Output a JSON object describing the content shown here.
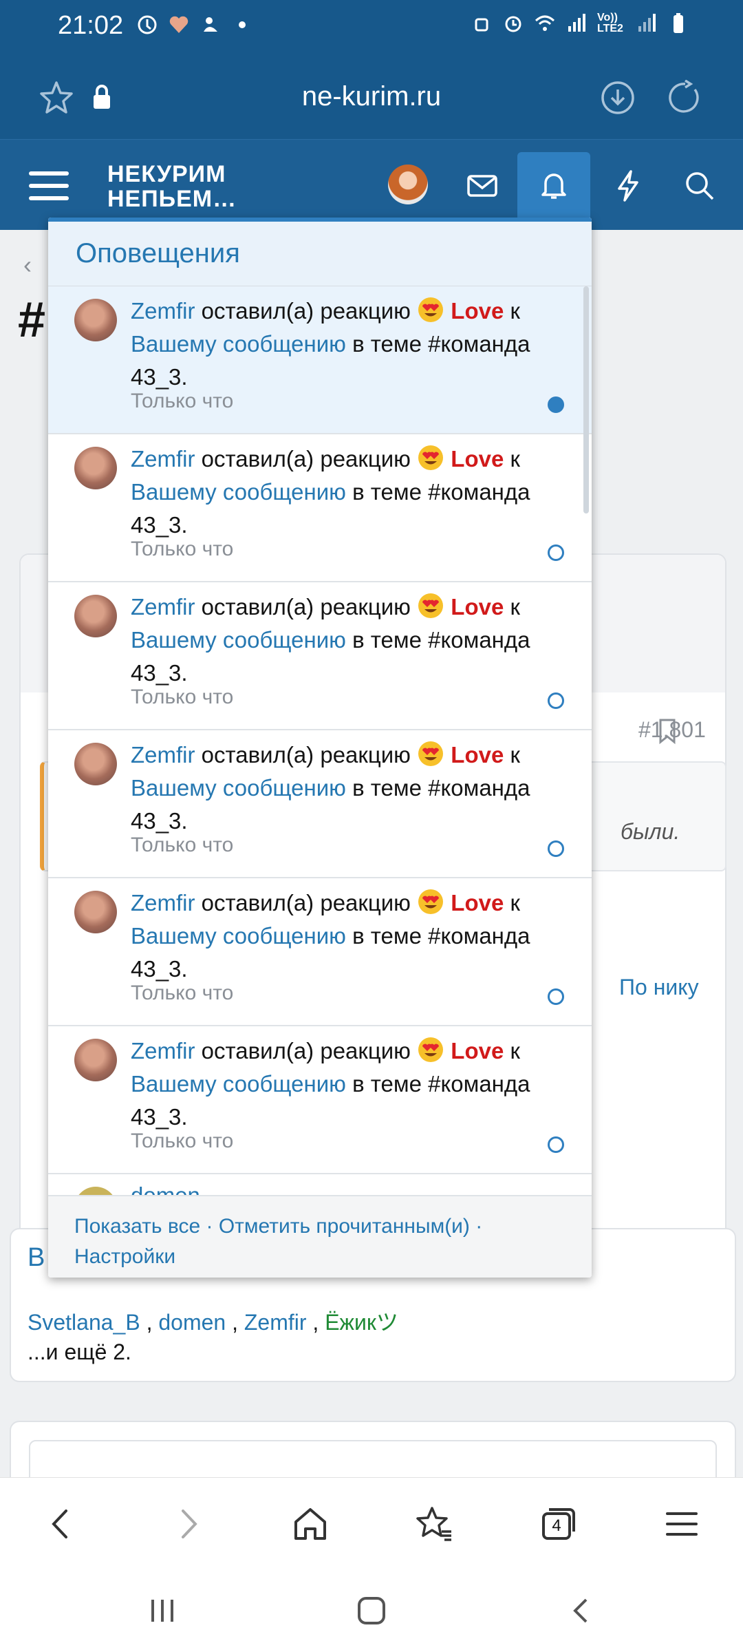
{
  "status_bar": {
    "time": "21:02",
    "network": "Vo)) LTE2"
  },
  "browser": {
    "url": "ne-kurim.ru"
  },
  "site": {
    "logo_line1": "НЕКУРИМ",
    "logo_line2": "НЕПЬЕМ…"
  },
  "background": {
    "post_number": "#1.801",
    "quote_fragment": "были.",
    "by_nick_link": "По нику",
    "truncated_title_char": "#",
    "section_initial": "В",
    "users": [
      "Svetlana_B",
      "domen",
      "Zemfir",
      "Ёжикツ"
    ],
    "and_more": "...и ещё 2."
  },
  "notifications": {
    "title": "Оповещения",
    "items": [
      {
        "user": "Zemfir",
        "action": "оставил(а) реакцию",
        "reaction": "Love",
        "preposition": "к",
        "link": "Вашему сообщению",
        "suffix": "в теме #команда 43_3.",
        "time": "Только что",
        "unread": true
      },
      {
        "user": "Zemfir",
        "action": "оставил(а) реакцию",
        "reaction": "Love",
        "preposition": "к",
        "link": "Вашему сообщению",
        "suffix": "в теме #команда 43_3.",
        "time": "Только что",
        "unread": false
      },
      {
        "user": "Zemfir",
        "action": "оставил(а) реакцию",
        "reaction": "Love",
        "preposition": "к",
        "link": "Вашему сообщению",
        "suffix": "в теме #команда 43_3.",
        "time": "Только что",
        "unread": false
      },
      {
        "user": "Zemfir",
        "action": "оставил(а) реакцию",
        "reaction": "Love",
        "preposition": "к",
        "link": "Вашему сообщению",
        "suffix": "в теме #команда 43_3.",
        "time": "Только что",
        "unread": false
      },
      {
        "user": "Zemfir",
        "action": "оставил(а) реакцию",
        "reaction": "Love",
        "preposition": "к",
        "link": "Вашему сообщению",
        "suffix": "в теме #команда 43_3.",
        "time": "Только что",
        "unread": false
      },
      {
        "user": "Zemfir",
        "action": "оставил(а) реакцию",
        "reaction": "Love",
        "preposition": "к",
        "link": "Вашему сообщению",
        "suffix": "в теме #команда 43_3.",
        "time": "Только что",
        "unread": false
      }
    ],
    "partial_item_user": "domen",
    "footer": {
      "show_all": "Показать все",
      "mark_read": "Отметить прочитанным(и)",
      "settings": "Настройки",
      "separator": "·"
    }
  },
  "toolbar": {
    "tabs_count": "4"
  },
  "colors": {
    "header": "#17588b",
    "accent": "#2f7fc0",
    "link": "#2577b1",
    "love": "#d11a1a"
  }
}
